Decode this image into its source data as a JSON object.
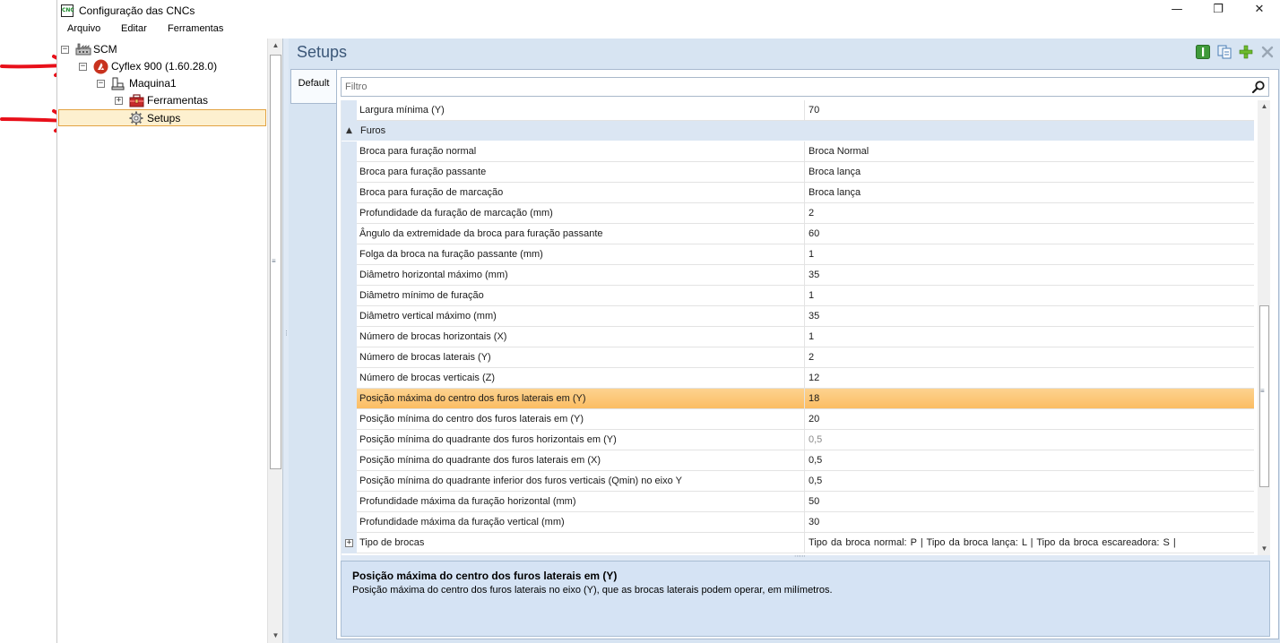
{
  "window": {
    "title": "Configuração das CNCs",
    "app_icon_text": "CNC",
    "controls": {
      "minimize": "—",
      "maximize": "❐",
      "close": "✕"
    }
  },
  "menu": [
    "Arquivo",
    "Editar",
    "Ferramentas"
  ],
  "tree": {
    "items": [
      {
        "label": "SCM",
        "expander": "−"
      },
      {
        "label": "Cyflex 900 (1.60.28.0)",
        "expander": "−"
      },
      {
        "label": "Maquina1",
        "expander": "−"
      },
      {
        "label": "Ferramentas",
        "expander": "+"
      },
      {
        "label": "Setups",
        "selected": true
      }
    ]
  },
  "main": {
    "title": "Setups",
    "tab": "Default",
    "filter_placeholder": "Filtro"
  },
  "grid": {
    "top_row": {
      "name": "Largura mínima (Y)",
      "value": "70"
    },
    "category": {
      "name": "Furos",
      "collapse_glyph": "▲"
    },
    "rows": [
      {
        "name": "Broca para furação normal",
        "value": "Broca Normal"
      },
      {
        "name": "Broca para furação passante",
        "value": "Broca lança"
      },
      {
        "name": "Broca para furação de marcação",
        "value": "Broca lança"
      },
      {
        "name": "Profundidade da furação de marcação (mm)",
        "value": "2"
      },
      {
        "name": "Ângulo da extremidade da broca para furação passante",
        "value": "60"
      },
      {
        "name": "Folga da broca na furação passante (mm)",
        "value": "1"
      },
      {
        "name": "Diâmetro horizontal máximo (mm)",
        "value": "35"
      },
      {
        "name": "Diâmetro mínimo de furação",
        "value": "1"
      },
      {
        "name": "Diâmetro vertical máximo (mm)",
        "value": "35"
      },
      {
        "name": "Número de brocas horizontais (X)",
        "value": "1"
      },
      {
        "name": "Número de brocas laterais (Y)",
        "value": "2"
      },
      {
        "name": "Número de brocas verticais (Z)",
        "value": "12"
      },
      {
        "name": "Posição máxima do centro dos furos laterais em (Y)",
        "value": "18",
        "highlighted": true
      },
      {
        "name": "Posição mínima do centro dos furos laterais em (Y)",
        "value": "20"
      },
      {
        "name": "Posição mínima do quadrante dos furos horizontais em (Y)",
        "value": "0,5",
        "dimmed": true
      },
      {
        "name": "Posição mínima do quadrante dos furos laterais em (X)",
        "value": "0,5"
      },
      {
        "name": "Posição mínima do quadrante inferior dos furos verticais (Qmin) no eixo Y",
        "value": "0,5"
      },
      {
        "name": "Profundidade máxima da furação horizontal (mm)",
        "value": "50"
      },
      {
        "name": "Profundidade máxima da furação vertical (mm)",
        "value": "30"
      }
    ],
    "bottom_row": {
      "name": "Tipo de brocas",
      "value": "Tipo da broca normal: P  |  Tipo da broca lança: L  |  Tipo da broca escareadora: S  |",
      "expander": "+"
    }
  },
  "description": {
    "title": "Posição máxima do centro dos furos laterais em (Y)",
    "text": "Posição máxima do centro dos furos laterais no eixo (Y), que as brocas laterais podem operar, em milímetros."
  },
  "colors": {
    "arrow_red": "#e8101a",
    "highlight": "#fbbd63",
    "panel_blue": "#d7e4f2",
    "title_blue": "#3b5778",
    "tree_selected": "#fdf0cf"
  }
}
